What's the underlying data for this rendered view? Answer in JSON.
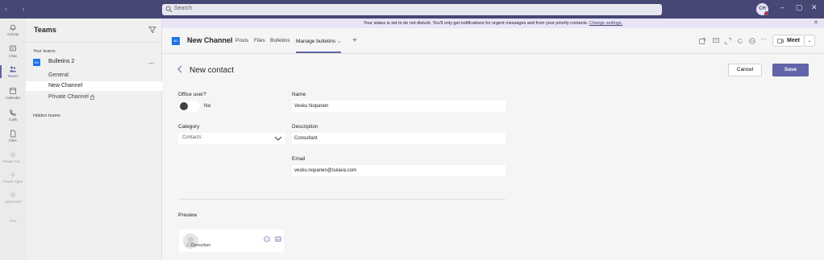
{
  "titlebar": {
    "search_placeholder": "Search",
    "avatar_initials": "CH",
    "colors": {
      "titlebar": "#464775",
      "accent": "#6264a7",
      "status_dnd": "#c4314b"
    }
  },
  "banner": {
    "text": "Your status is set to do not disturb. You'll only get notifications for urgent messages and from your priority contacts.",
    "link": "Change settings."
  },
  "rail": {
    "items": [
      {
        "label": "Activity",
        "icon": "bell-icon"
      },
      {
        "label": "Chat",
        "icon": "chat-icon"
      },
      {
        "label": "Teams",
        "icon": "teams-icon",
        "active": true
      },
      {
        "label": "Calendar",
        "icon": "calendar-icon"
      },
      {
        "label": "Calls",
        "icon": "phone-icon"
      },
      {
        "label": "Files",
        "icon": "file-icon"
      },
      {
        "label": "Power Aut...",
        "icon": "power-automate-icon"
      },
      {
        "label": "Power Apps",
        "icon": "power-apps-icon"
      },
      {
        "label": "Approvals",
        "icon": "approvals-icon"
      }
    ],
    "more": "..."
  },
  "teams": {
    "title": "Teams",
    "your_teams": "Your teams",
    "team_badge": "B2",
    "team_name": "Bulletins 2",
    "more": "...",
    "channels": [
      "General",
      "New Channel",
      "Private Channel"
    ],
    "hidden_teams": "Hidden teams"
  },
  "header": {
    "badge": "B2",
    "channel": "New Channel",
    "tabs": [
      "Posts",
      "Files",
      "Bulletins",
      "Manage bulletins"
    ],
    "add": "+",
    "meet": "Meet",
    "more": "···"
  },
  "form": {
    "title": "New contact",
    "cancel": "Cancel",
    "save": "Save",
    "office_user_label": "Office user?",
    "office_user_value": "No",
    "category_label": "Category",
    "category_value": "Contacts",
    "name_label": "Name",
    "name_value": "Vesku Nopanen",
    "description_label": "Description",
    "description_value": "Consultant",
    "email_label": "Email",
    "email_value": "vesku.nopanen@sulava.com",
    "preview_label": "Preview",
    "preview_subtitle": "Consultant"
  }
}
